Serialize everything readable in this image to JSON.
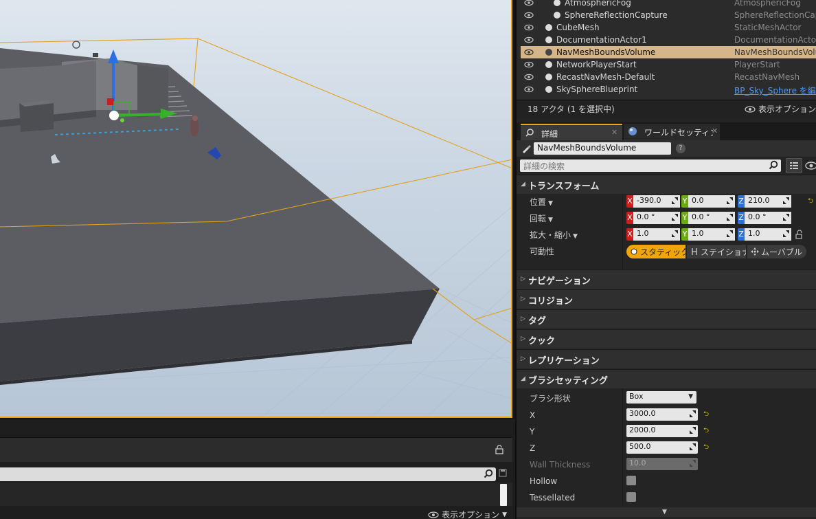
{
  "outliner": {
    "rows": [
      {
        "name": "AtmosphericFog",
        "type": "AtmosphericFog",
        "selected": false,
        "indent": 2
      },
      {
        "name": "SphereReflectionCapture",
        "type": "SphereReflectionCapt",
        "selected": false,
        "indent": 2
      },
      {
        "name": "CubeMesh",
        "type": "StaticMeshActor",
        "selected": false,
        "indent": 1
      },
      {
        "name": "DocumentationActor1",
        "type": "DocumentationActor",
        "selected": false,
        "indent": 1
      },
      {
        "name": "NavMeshBoundsVolume",
        "type": "NavMeshBoundsVolu",
        "selected": true,
        "indent": 1
      },
      {
        "name": "NetworkPlayerStart",
        "type": "PlayerStart",
        "selected": false,
        "indent": 1
      },
      {
        "name": "RecastNavMesh-Default",
        "type": "RecastNavMesh",
        "selected": false,
        "indent": 1
      },
      {
        "name": "SkySphereBlueprint",
        "type": "BP_Sky_Sphere を編",
        "selected": false,
        "indent": 1,
        "link": true
      }
    ],
    "count_text": "18 アクタ (1 を選択中)",
    "view_options": "表示オプション"
  },
  "tabs": [
    {
      "label": "詳細",
      "active": true
    },
    {
      "label": "ワールドセッティング",
      "active": false
    }
  ],
  "details": {
    "actor_name": "NavMeshBoundsVolume",
    "search_placeholder": "詳細の検索",
    "categories": {
      "transform": "トランスフォーム",
      "navigation": "ナビゲーション",
      "collision": "コリジョン",
      "tags": "タグ",
      "cook": "クック",
      "replication": "レプリケーション",
      "brush_settings": "ブラシセッティング"
    },
    "transform": {
      "location_label": "位置",
      "rotation_label": "回転",
      "scale_label": "拡大・縮小",
      "mobility_label": "可動性",
      "location": {
        "x": "-390.0",
        "y": "0.0",
        "z": "210.0"
      },
      "rotation": {
        "x": "0.0 °",
        "y": "0.0 °",
        "z": "0.0 °"
      },
      "scale": {
        "x": "1.0",
        "y": "1.0",
        "z": "1.0"
      },
      "axis_x": "X",
      "axis_y": "Y",
      "axis_z": "Z",
      "mobility": {
        "static": "スタティック",
        "stationary": "ステイショナリー",
        "movable": "ムーバブル"
      }
    },
    "brush": {
      "shape_label": "ブラシ形状",
      "shape_value": "Box",
      "x_label": "X",
      "x_value": "3000.0",
      "y_label": "Y",
      "y_value": "2000.0",
      "z_label": "Z",
      "z_value": "500.0",
      "wall_label": "Wall Thickness",
      "wall_value": "10.0",
      "hollow_label": "Hollow",
      "tessellated_label": "Tessellated"
    }
  },
  "bottom_left": {
    "view_options": "表示オプション"
  },
  "colors": {
    "selection": "#d4b68a",
    "accent": "#f0a60a",
    "axis_x": "#c92020",
    "axis_y": "#6cab14",
    "axis_z": "#2e70d4"
  }
}
